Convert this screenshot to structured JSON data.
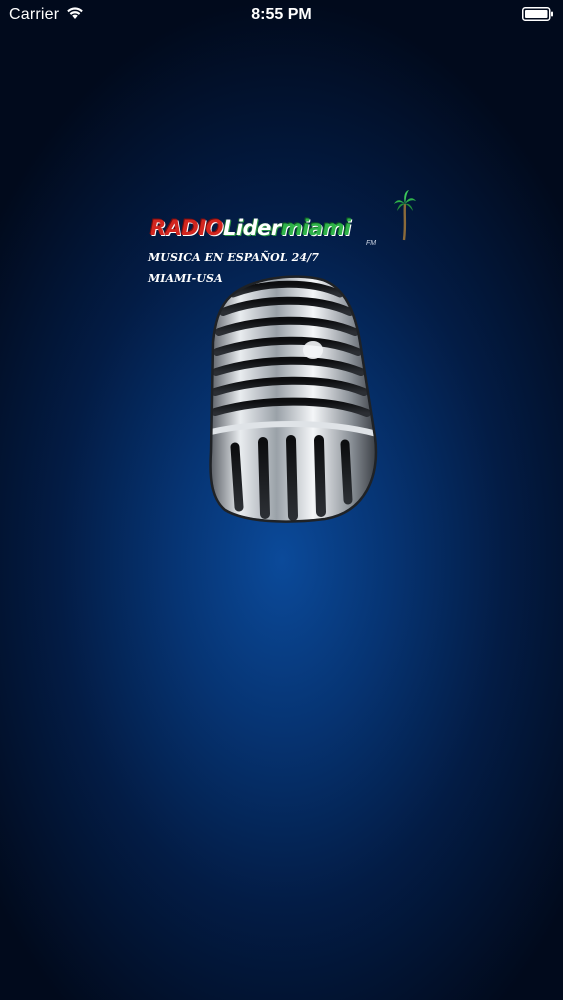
{
  "status_bar": {
    "carrier": "Carrier",
    "time": "8:55 PM",
    "wifi_icon": "wifi-icon",
    "battery_icon": "battery-icon"
  },
  "splash": {
    "logo": {
      "part_radio": "RADIO",
      "part_lider": "Lider",
      "part_miami": "miami",
      "suffix": "FM"
    },
    "tagline_line1": "MUSICA EN ESPAÑOL 24/7",
    "tagline_line2": "MIAMI-USA",
    "image_icon": "microphone-icon"
  },
  "colors": {
    "background_center": "#0b4a9a",
    "background_edge": "#010a1c",
    "logo_red": "#d2261f",
    "logo_green": "#2fb34a",
    "text_white": "#ffffff"
  }
}
